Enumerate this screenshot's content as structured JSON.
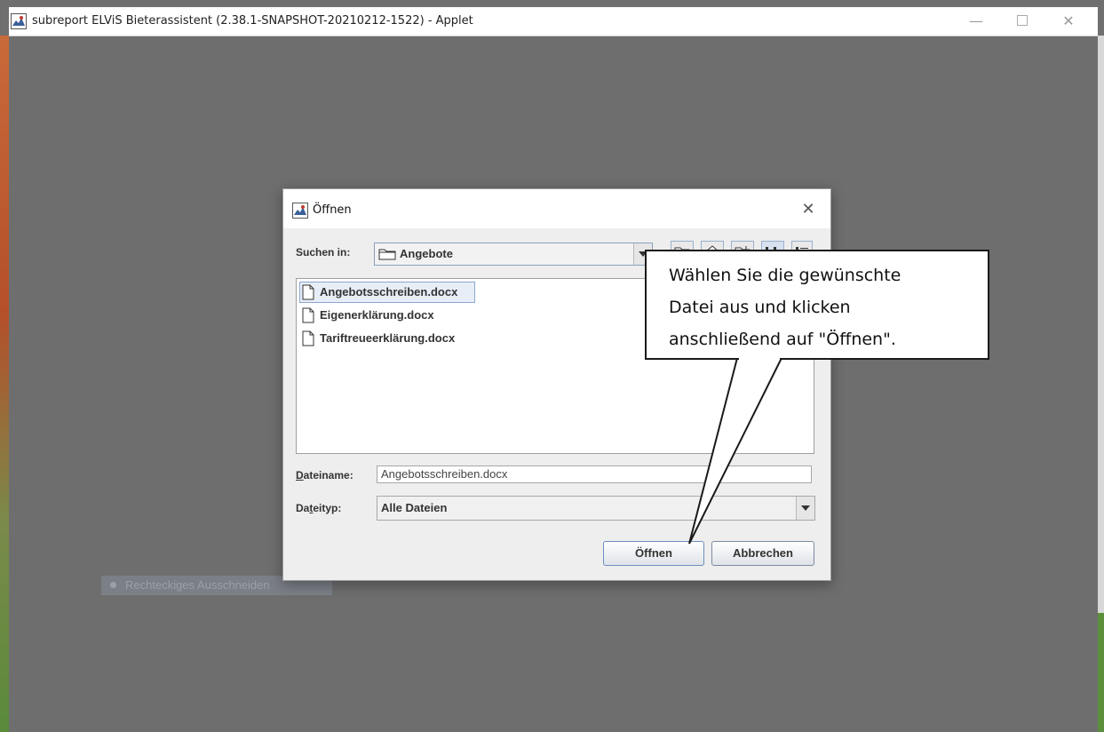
{
  "window": {
    "title": "subreport ELViS Bieterassistent (2.38.1-SNAPSHOT-20210212-1522) - Applet",
    "minimize_glyph": "—",
    "close_glyph": "✕"
  },
  "background": {
    "checkbox_label": "Rechteckiges Ausschneiden"
  },
  "dialog": {
    "title": "Öffnen",
    "close_glyph": "✕",
    "look_in_label": "Suchen in:",
    "look_in_folder": "Angebote",
    "toolbar_icons": [
      "up-folder-icon",
      "home-icon",
      "new-folder-icon",
      "list-view-icon",
      "details-view-icon"
    ],
    "files": [
      {
        "name": "Angebotsschreiben.docx",
        "selected": true
      },
      {
        "name": "Eigenerklärung.docx",
        "selected": false
      },
      {
        "name": "Tariftreueerklärung.docx",
        "selected": false
      }
    ],
    "file_name_label": "Dateiname:",
    "file_name_value": "Angebotsschreiben.docx",
    "file_type_label": "Dateityp:",
    "file_type_value": "Alle Dateien",
    "open_button": "Öffnen",
    "cancel_button": "Abbrechen"
  },
  "callout": {
    "lines": [
      "Wählen Sie die gewünschte",
      "Datei aus und klicken",
      "anschließend auf \"Öffnen\"."
    ]
  },
  "colors": {
    "accent": "#6f8fc0",
    "overlay": "#6f6f6f",
    "selection": "#e8eef8"
  }
}
